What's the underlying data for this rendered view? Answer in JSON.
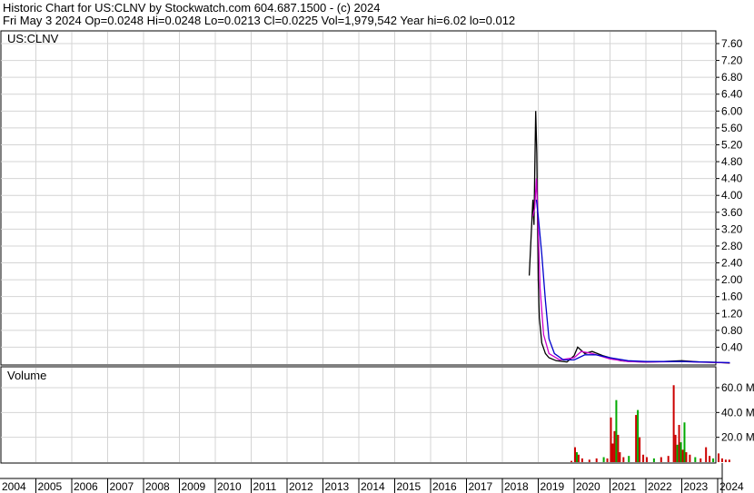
{
  "header": {
    "line1": "Historic Chart for US:CLNV by Stockwatch.com 604.687.1500 - (c) 2024",
    "line2": "Fri May  3 2024   Op=0.0248   Hi=0.0248   Lo=0.0213   Cl=0.0225   Vol=1,979,542   Year hi=6.02   lo=0.012"
  },
  "chart_data": {
    "type": "line",
    "symbol_label": "US:CLNV",
    "volume_label": "Volume",
    "x_labels": [
      "2004",
      "2005",
      "2006",
      "2007",
      "2008",
      "2009",
      "2010",
      "2011",
      "2012",
      "2013",
      "2014",
      "2015",
      "2016",
      "2017",
      "2018",
      "2019",
      "2020",
      "2021",
      "2022",
      "2023",
      "2024"
    ],
    "price_ticks": [
      "7.60",
      "7.20",
      "6.80",
      "6.40",
      "6.00",
      "5.60",
      "5.20",
      "4.80",
      "4.40",
      "4.00",
      "3.60",
      "3.20",
      "2.80",
      "2.40",
      "2.00",
      "1.60",
      "1.20",
      "0.80",
      "0.40"
    ],
    "volume_ticks": [
      "60.0 M",
      "40.0 M",
      "20.0 M"
    ],
    "price_ylim": [
      0,
      7.6
    ],
    "volume_ylim": [
      0,
      60
    ],
    "grid": true,
    "series": [
      {
        "name": "",
        "color": "#000000",
        "points": [
          [
            2018.75,
            2.1
          ],
          [
            2018.8,
            3.0
          ],
          [
            2018.85,
            3.9
          ],
          [
            2018.88,
            3.3
          ],
          [
            2018.9,
            4.5
          ],
          [
            2018.93,
            6.0
          ],
          [
            2018.96,
            5.0
          ],
          [
            2019.0,
            2.0
          ],
          [
            2019.03,
            1.1
          ],
          [
            2019.1,
            0.5
          ],
          [
            2019.2,
            0.25
          ],
          [
            2019.3,
            0.15
          ],
          [
            2019.5,
            0.08
          ],
          [
            2019.8,
            0.05
          ],
          [
            2020.0,
            0.2
          ],
          [
            2020.1,
            0.4
          ],
          [
            2020.3,
            0.25
          ],
          [
            2020.5,
            0.3
          ],
          [
            2020.8,
            0.2
          ],
          [
            2021.0,
            0.15
          ],
          [
            2021.3,
            0.08
          ],
          [
            2021.6,
            0.06
          ],
          [
            2022.0,
            0.05
          ],
          [
            2022.5,
            0.06
          ],
          [
            2023.0,
            0.08
          ],
          [
            2023.5,
            0.05
          ],
          [
            2024.0,
            0.04
          ],
          [
            2024.34,
            0.0225
          ]
        ]
      },
      {
        "name": "",
        "color": "#cc00cc",
        "points": [
          [
            2018.85,
            3.5
          ],
          [
            2018.9,
            3.7
          ],
          [
            2018.95,
            4.4
          ],
          [
            2019.0,
            3.2
          ],
          [
            2019.05,
            1.8
          ],
          [
            2019.15,
            0.7
          ],
          [
            2019.3,
            0.25
          ],
          [
            2019.6,
            0.1
          ],
          [
            2020.0,
            0.15
          ],
          [
            2020.2,
            0.3
          ],
          [
            2020.5,
            0.25
          ],
          [
            2021.0,
            0.12
          ],
          [
            2021.5,
            0.06
          ],
          [
            2022.0,
            0.05
          ],
          [
            2023.0,
            0.06
          ],
          [
            2024.0,
            0.035
          ],
          [
            2024.34,
            0.03
          ]
        ]
      },
      {
        "name": "",
        "color": "#0000cc",
        "points": [
          [
            2018.95,
            3.9
          ],
          [
            2019.0,
            3.5
          ],
          [
            2019.1,
            2.6
          ],
          [
            2019.2,
            1.5
          ],
          [
            2019.3,
            0.6
          ],
          [
            2019.45,
            0.25
          ],
          [
            2019.7,
            0.1
          ],
          [
            2020.0,
            0.1
          ],
          [
            2020.3,
            0.22
          ],
          [
            2020.6,
            0.22
          ],
          [
            2021.0,
            0.15
          ],
          [
            2021.5,
            0.08
          ],
          [
            2022.0,
            0.06
          ],
          [
            2023.0,
            0.06
          ],
          [
            2024.0,
            0.04
          ],
          [
            2024.34,
            0.035
          ]
        ]
      }
    ],
    "volume_bars": [
      [
        2019.9,
        1,
        "#cc0000"
      ],
      [
        2020.0,
        12,
        "#cc0000"
      ],
      [
        2020.05,
        8,
        "#00aa00"
      ],
      [
        2020.1,
        6,
        "#cc0000"
      ],
      [
        2020.2,
        3,
        "#cc0000"
      ],
      [
        2020.4,
        2,
        "#cc0000"
      ],
      [
        2020.6,
        3,
        "#cc0000"
      ],
      [
        2020.8,
        4,
        "#00aa00"
      ],
      [
        2020.9,
        3,
        "#cc0000"
      ],
      [
        2021.0,
        36,
        "#cc0000"
      ],
      [
        2021.05,
        15,
        "#cc0000"
      ],
      [
        2021.1,
        25,
        "#cc0000"
      ],
      [
        2021.15,
        50,
        "#00aa00"
      ],
      [
        2021.2,
        22,
        "#cc0000"
      ],
      [
        2021.25,
        8,
        "#cc0000"
      ],
      [
        2021.35,
        4,
        "#cc0000"
      ],
      [
        2021.5,
        5,
        "#00aa00"
      ],
      [
        2021.7,
        38,
        "#cc0000"
      ],
      [
        2021.75,
        42,
        "#00aa00"
      ],
      [
        2021.8,
        20,
        "#cc0000"
      ],
      [
        2021.9,
        6,
        "#cc0000"
      ],
      [
        2022.0,
        4,
        "#cc0000"
      ],
      [
        2022.2,
        3,
        "#00aa00"
      ],
      [
        2022.4,
        4,
        "#cc0000"
      ],
      [
        2022.6,
        5,
        "#cc0000"
      ],
      [
        2022.75,
        62,
        "#cc0000"
      ],
      [
        2022.8,
        22,
        "#cc0000"
      ],
      [
        2022.85,
        14,
        "#00aa00"
      ],
      [
        2022.9,
        30,
        "#cc0000"
      ],
      [
        2022.95,
        16,
        "#00aa00"
      ],
      [
        2023.0,
        10,
        "#cc0000"
      ],
      [
        2023.05,
        32,
        "#00aa00"
      ],
      [
        2023.1,
        8,
        "#cc0000"
      ],
      [
        2023.2,
        6,
        "#cc0000"
      ],
      [
        2023.35,
        4,
        "#00aa00"
      ],
      [
        2023.5,
        3,
        "#cc0000"
      ],
      [
        2023.65,
        12,
        "#cc0000"
      ],
      [
        2023.75,
        5,
        "#cc0000"
      ],
      [
        2023.85,
        3,
        "#00aa00"
      ],
      [
        2024.0,
        7,
        "#cc0000"
      ],
      [
        2024.1,
        3,
        "#cc0000"
      ],
      [
        2024.2,
        2,
        "#cc0000"
      ],
      [
        2024.3,
        2,
        "#cc0000"
      ]
    ]
  }
}
